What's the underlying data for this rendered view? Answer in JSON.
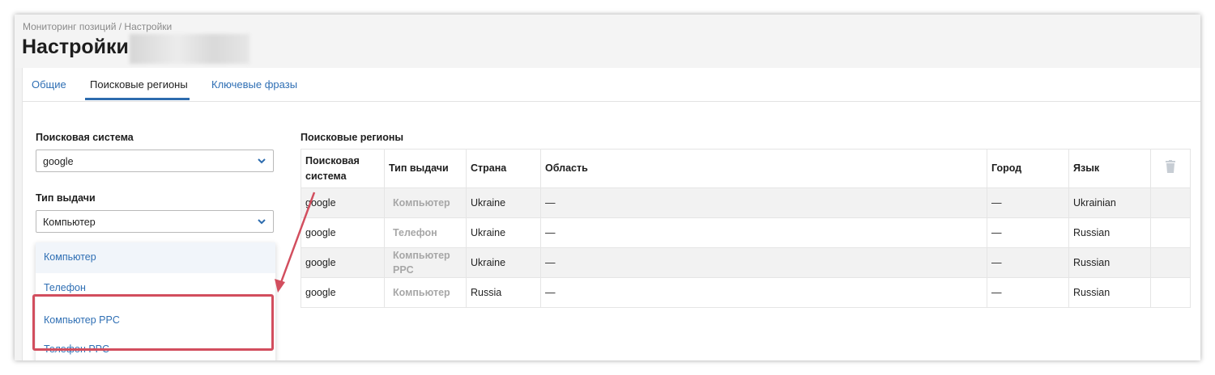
{
  "breadcrumb": "Мониторинг позиций / Настройки",
  "page_title": "Настройки",
  "tabs": [
    {
      "label": "Общие",
      "active": false
    },
    {
      "label": "Поисковые регионы",
      "active": true
    },
    {
      "label": "Ключевые фразы",
      "active": false
    }
  ],
  "form": {
    "engine_label": "Поисковая система",
    "engine_value": "google",
    "output_type_label": "Тип выдачи",
    "output_type_value": "Компьютер"
  },
  "dropdown": {
    "options": [
      "Компьютер",
      "Телефон",
      "Компьютер PPC",
      "Телефон PPC"
    ],
    "highlighted": "Компьютер"
  },
  "regions": {
    "title": "Поисковые регионы",
    "columns": [
      "Поисковая система",
      "Тип выдачи",
      "Страна",
      "Область",
      "Город",
      "Язык"
    ],
    "rows": [
      {
        "engine": "google",
        "type": "Компьютер",
        "country": "Ukraine",
        "region": "—",
        "city": "—",
        "language": "Ukrainian"
      },
      {
        "engine": "google",
        "type": "Телефон",
        "country": "Ukraine",
        "region": "—",
        "city": "—",
        "language": "Russian"
      },
      {
        "engine": "google",
        "type": "Компьютер PPC",
        "country": "Ukraine",
        "region": "—",
        "city": "—",
        "language": "Russian"
      },
      {
        "engine": "google",
        "type": "Компьютер",
        "country": "Russia",
        "region": "—",
        "city": "—",
        "language": "Russian"
      }
    ]
  },
  "icons": {
    "select_chevron": "chevron-down-icon",
    "delete": "trash-icon"
  },
  "colors": {
    "link": "#2f6fb4",
    "accent": "#2d6cae",
    "highlight_annotation": "#d24e5e",
    "muted": "#a7a7a7"
  }
}
